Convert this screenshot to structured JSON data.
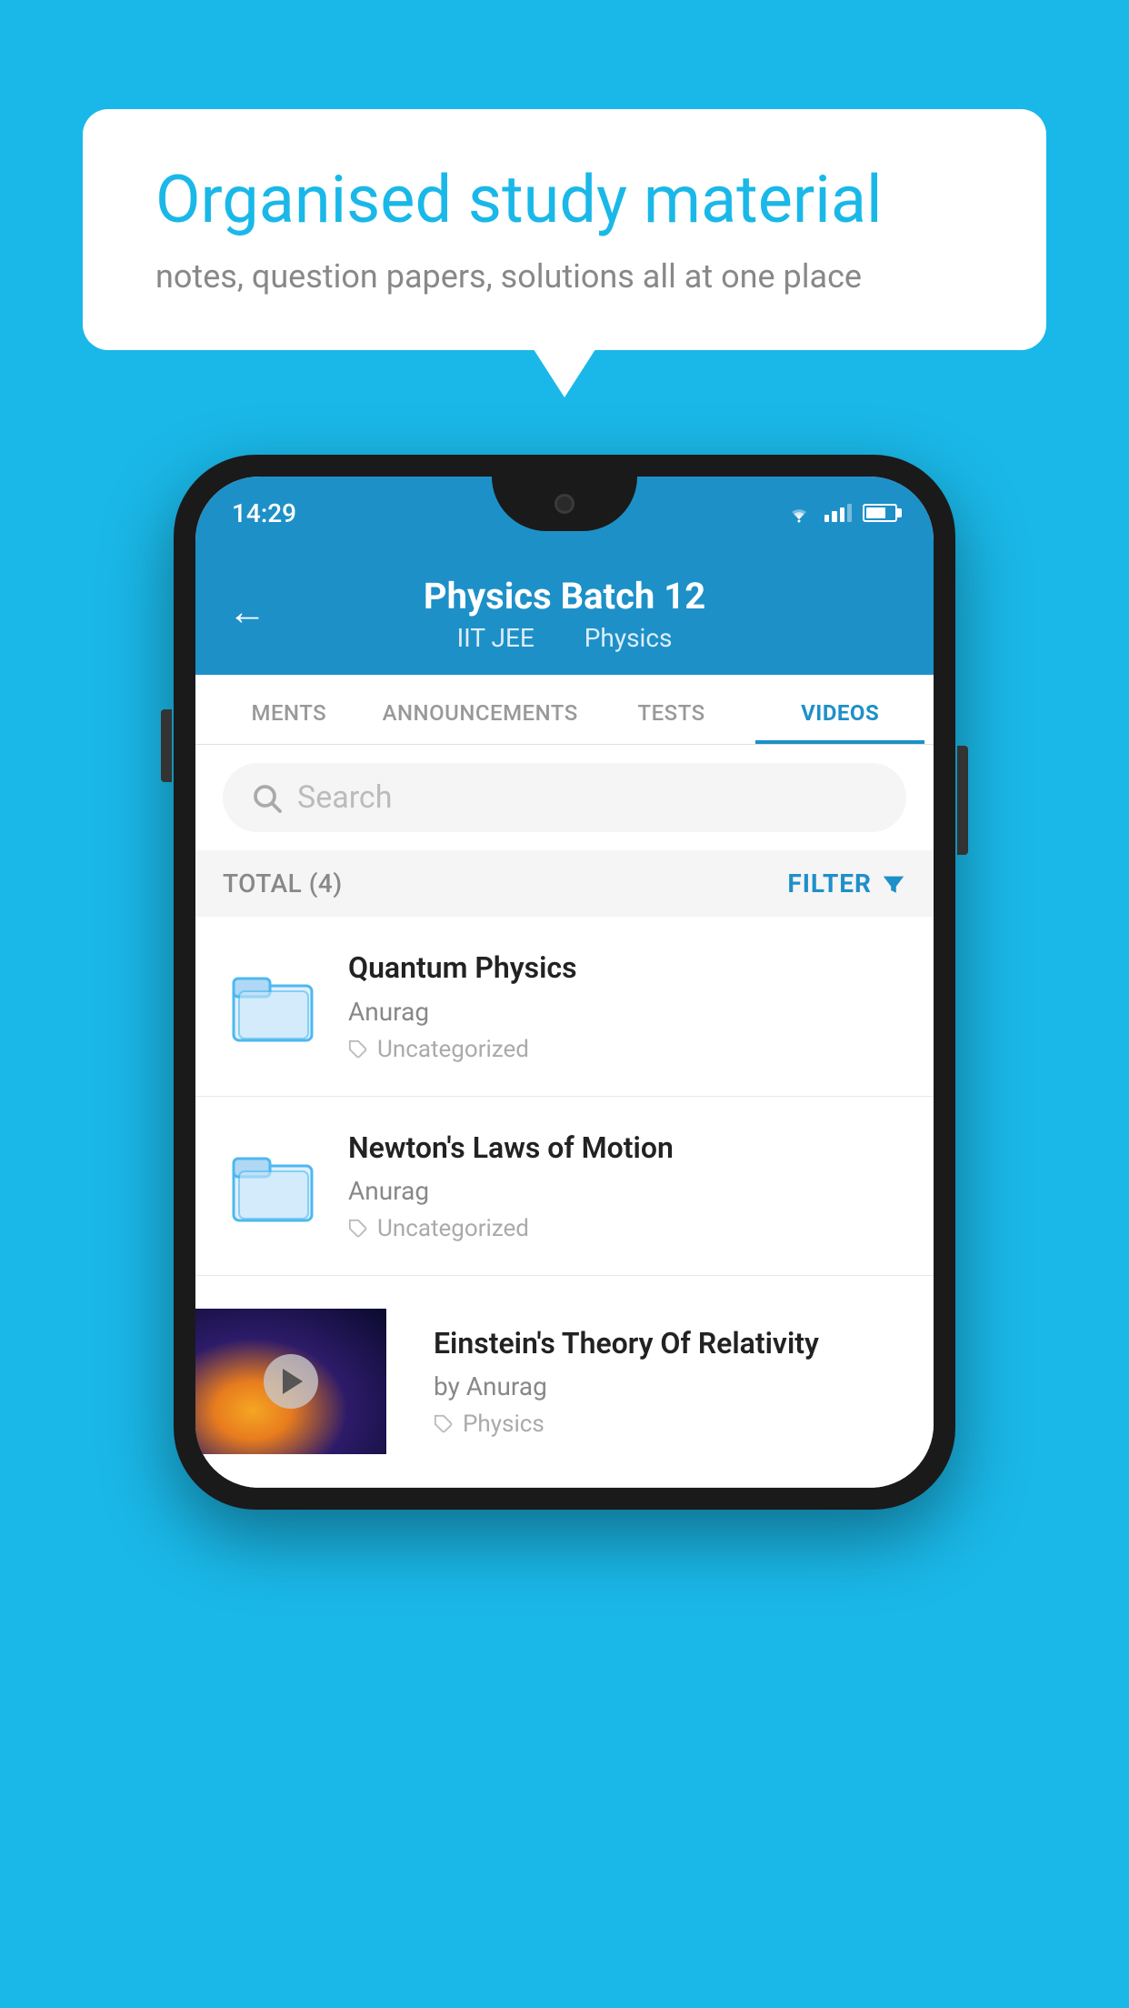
{
  "background_color": "#1ab8e8",
  "bubble": {
    "title": "Organised study material",
    "subtitle": "notes, question papers, solutions all at one place"
  },
  "status_bar": {
    "time": "14:29"
  },
  "header": {
    "title": "Physics Batch 12",
    "subtitle_part1": "IIT JEE",
    "subtitle_part2": "Physics"
  },
  "tabs": [
    {
      "label": "MENTS",
      "active": false
    },
    {
      "label": "ANNOUNCEMENTS",
      "active": false
    },
    {
      "label": "TESTS",
      "active": false
    },
    {
      "label": "VIDEOS",
      "active": true
    }
  ],
  "search": {
    "placeholder": "Search"
  },
  "filter_bar": {
    "total_label": "TOTAL (4)",
    "filter_label": "FILTER"
  },
  "videos": [
    {
      "id": 1,
      "title": "Quantum Physics",
      "author": "Anurag",
      "tag": "Uncategorized",
      "type": "folder",
      "has_thumbnail": false
    },
    {
      "id": 2,
      "title": "Newton's Laws of Motion",
      "author": "Anurag",
      "tag": "Uncategorized",
      "type": "folder",
      "has_thumbnail": false
    },
    {
      "id": 3,
      "title": "Einstein's Theory Of Relativity",
      "author": "by Anurag",
      "tag": "Physics",
      "type": "video",
      "has_thumbnail": true
    }
  ]
}
